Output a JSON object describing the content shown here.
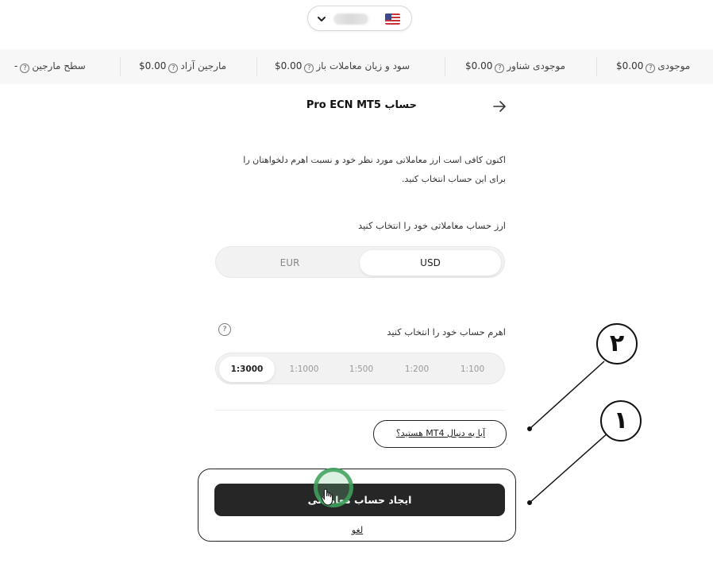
{
  "header": {
    "title": "حساب Pro ECN MT5"
  },
  "stats": [
    {
      "label": "موجودی",
      "value": "$0.00"
    },
    {
      "label": "موجودی شناور",
      "value": "$0.00"
    },
    {
      "label": "سود و زیان معاملات باز",
      "value": "$0.00"
    },
    {
      "label": "مارجین آزاد",
      "value": "$0.00"
    },
    {
      "label": "سطح مارجین",
      "value": "-"
    }
  ],
  "help_glyph": "?",
  "intro": "اکنون کافی است ارز معاملاتی مورد نظر خود و نسبت اهرم دلخواهتان را برای این حساب انتخاب کنید.",
  "currency": {
    "label": "ارز حساب معاملاتی خود را انتخاب کنید",
    "options": [
      "USD",
      "EUR"
    ],
    "selected": "USD"
  },
  "leverage": {
    "label": "اهرم حساب خود را انتخاب کنید",
    "options": [
      "1:100",
      "1:200",
      "1:500",
      "1:1000",
      "1:3000"
    ],
    "selected": "1:3000"
  },
  "mt4_link": "آیا یه دنبال MT4 هستید؟",
  "create_button": "ایجاد حساب معاملاتی",
  "cancel_link": "لغو",
  "annotations": {
    "one": "۱",
    "two": "۲"
  },
  "colors": {
    "button_bg": "#262626",
    "cursor_ring": "#3ca05a",
    "stats_bg": "#f7f7f7"
  }
}
